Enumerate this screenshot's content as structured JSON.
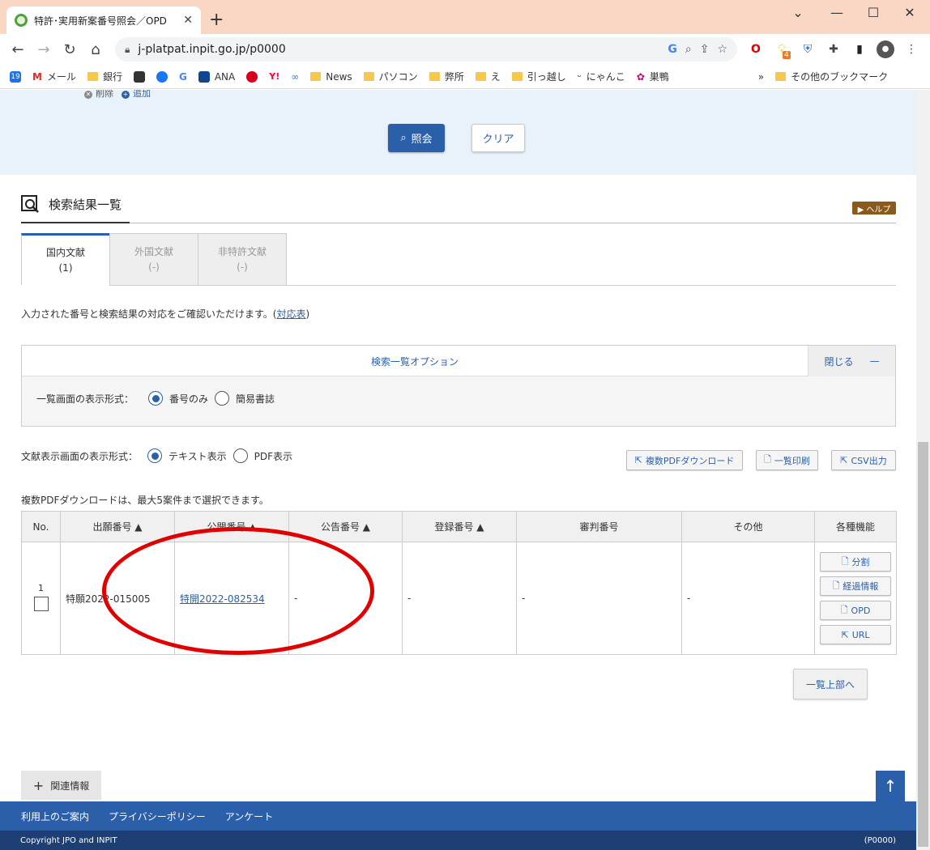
{
  "browser": {
    "tab_title": "特許･実用新案番号照会／OPD",
    "url": "j-platpat.inpit.go.jp/p0000",
    "bookmarks": [
      "メール",
      "銀行",
      "ANA",
      "News",
      "パソコン",
      "弊所",
      "え",
      "引っ越し",
      "にゃんこ",
      "巣鴨"
    ],
    "other_bookmarks": "その他のブックマーク",
    "calendar_day": "19",
    "ext_badge": "4"
  },
  "search": {
    "delete_label": "削除",
    "add_label": "追加",
    "query_button": "照会",
    "clear_button": "クリア"
  },
  "results": {
    "title": "検索結果一覧",
    "help_label": "▶ ヘルプ",
    "tabs": [
      {
        "label": "国内文献",
        "count": "(1)"
      },
      {
        "label": "外国文献",
        "count": "(-)"
      },
      {
        "label": "非特許文献",
        "count": "(-)"
      }
    ],
    "info_text": "入力された番号と検索結果の対応をご確認いただけます。(",
    "info_link": "対応表",
    "info_close": ")"
  },
  "options": {
    "title": "検索一覧オプション",
    "close_label": "閉じる",
    "list_format_label": "一覧画面の表示形式：",
    "list_format_opt1": "番号のみ",
    "list_format_opt2": "簡易書誌"
  },
  "doc_display": {
    "label": "文献表示画面の表示形式：",
    "opt_text": "テキスト表示",
    "opt_pdf": "PDF表示",
    "btn_multipdf": "複数PDFダウンロード",
    "btn_print": "一覧印刷",
    "btn_csv": "CSV出力",
    "multi_note": "複数PDFダウンロードは、最大5案件まで選択できます。"
  },
  "table": {
    "headers": [
      "No.",
      "出願番号 ▲",
      "公開番号 ▲",
      "公告番号 ▲",
      "登録番号 ▲",
      "審判番号",
      "その他",
      "各種機能"
    ],
    "rows": [
      {
        "no": "1",
        "application": "特願2022-015005",
        "publication": "特開2022-082534",
        "announcement": "-",
        "registration": "-",
        "appeal": "-",
        "other": "-"
      }
    ],
    "func_buttons": [
      "分割",
      "経過情報",
      "OPD",
      "URL"
    ]
  },
  "footer": {
    "back_to_top": "一覧上部へ",
    "related": "関連情報",
    "links": [
      "利用上のご案内",
      "プライバシーポリシー",
      "アンケート"
    ],
    "copyright": "Copyright JPO and INPIT",
    "page_id": "(P0000)"
  },
  "colors": {
    "accent": "#2b5faa",
    "annotation": "#e00000",
    "tabbar": "#fad6c4"
  }
}
